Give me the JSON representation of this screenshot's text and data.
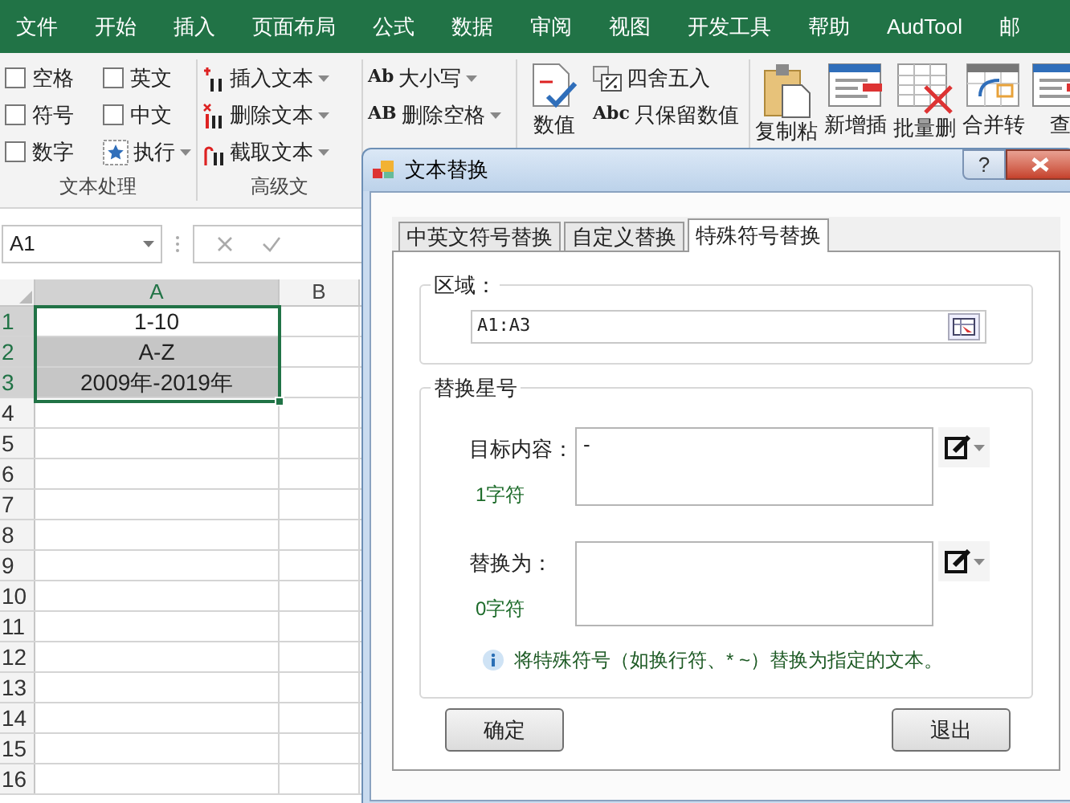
{
  "menu_tabs": [
    {
      "label": "文件"
    },
    {
      "label": "开始"
    },
    {
      "label": "插入"
    },
    {
      "label": "页面布局"
    },
    {
      "label": "公式"
    },
    {
      "label": "数据"
    },
    {
      "label": "审阅"
    },
    {
      "label": "视图"
    },
    {
      "label": "开发工具"
    },
    {
      "label": "帮助"
    },
    {
      "label": "AudTool"
    },
    {
      "label": "邮"
    }
  ],
  "ribbon": {
    "groups": [
      {
        "label": "文本处理",
        "items": [
          {
            "kind": "checkbox",
            "label": "空格",
            "checked": false
          },
          {
            "kind": "checkbox",
            "label": "英文",
            "checked": false
          },
          {
            "kind": "checkbox",
            "label": "符号",
            "checked": false
          },
          {
            "kind": "checkbox",
            "label": "中文",
            "checked": false
          },
          {
            "kind": "checkbox",
            "label": "数字",
            "checked": false
          },
          {
            "kind": "menu",
            "label": "执行"
          }
        ]
      },
      {
        "label": "高级文",
        "items": [
          {
            "kind": "menu",
            "label": "插入文本"
          },
          {
            "kind": "menu",
            "label": "删除文本"
          },
          {
            "kind": "menu",
            "label": "截取文本"
          }
        ]
      },
      {
        "items": [
          {
            "kind": "menu",
            "label": "大小写",
            "icon_text": "Ab"
          },
          {
            "kind": "menu",
            "label": "删除空格",
            "icon_text": "AB"
          }
        ]
      },
      {
        "items": [
          {
            "kind": "large",
            "label": "数值"
          },
          {
            "kind": "small",
            "label": "四舍五入"
          },
          {
            "kind": "small",
            "label": "只保留数值",
            "icon_text": "Abc"
          }
        ]
      },
      {
        "items": [
          {
            "kind": "large",
            "label": "复制粘"
          },
          {
            "kind": "large",
            "label": "新增插"
          },
          {
            "kind": "large",
            "label": "批量删"
          },
          {
            "kind": "large",
            "label": "合并转"
          },
          {
            "kind": "large",
            "label": "查"
          }
        ]
      }
    ]
  },
  "formula_bar": {
    "name_box": "A1"
  },
  "sheet": {
    "columns": [
      {
        "label": "A",
        "selected": true
      },
      {
        "label": "B",
        "selected": false
      }
    ],
    "rows": [
      {
        "number": "1",
        "selected": true,
        "cells": [
          {
            "value": "1-10",
            "selected": true,
            "active": true
          }
        ]
      },
      {
        "number": "2",
        "selected": true,
        "cells": [
          {
            "value": "A-Z",
            "selected": true,
            "active": false
          }
        ]
      },
      {
        "number": "3",
        "selected": true,
        "cells": [
          {
            "value": "2009年-2019年",
            "selected": true,
            "active": false
          }
        ]
      },
      {
        "number": "4",
        "selected": false,
        "cells": []
      },
      {
        "number": "5",
        "selected": false,
        "cells": []
      },
      {
        "number": "6",
        "selected": false,
        "cells": []
      },
      {
        "number": "7",
        "selected": false,
        "cells": []
      },
      {
        "number": "8",
        "selected": false,
        "cells": []
      },
      {
        "number": "9",
        "selected": false,
        "cells": []
      },
      {
        "number": "10",
        "selected": false,
        "cells": []
      },
      {
        "number": "11",
        "selected": false,
        "cells": []
      },
      {
        "number": "12",
        "selected": false,
        "cells": []
      },
      {
        "number": "13",
        "selected": false,
        "cells": []
      },
      {
        "number": "14",
        "selected": false,
        "cells": []
      },
      {
        "number": "15",
        "selected": false,
        "cells": []
      },
      {
        "number": "16",
        "selected": false,
        "cells": []
      }
    ]
  },
  "dialog": {
    "title": "文本替换",
    "help": "?",
    "tabs": [
      {
        "label": "中英文符号替换",
        "selected": false
      },
      {
        "label": "自定义替换",
        "selected": false
      },
      {
        "label": "特殊符号替换",
        "selected": true
      }
    ],
    "region": {
      "title": "区域：",
      "value": "A1:A3"
    },
    "replace": {
      "title": "替换星号",
      "fields": [
        {
          "label": "目标内容：",
          "count": "1字符",
          "value": "-"
        },
        {
          "label": "替换为：",
          "count": "0字符"
        }
      ],
      "info": "将特殊符号（如换行符、* ~）替换为指定的文本。"
    },
    "buttons": [
      {
        "label": "确定"
      },
      {
        "label": "退出"
      }
    ]
  }
}
